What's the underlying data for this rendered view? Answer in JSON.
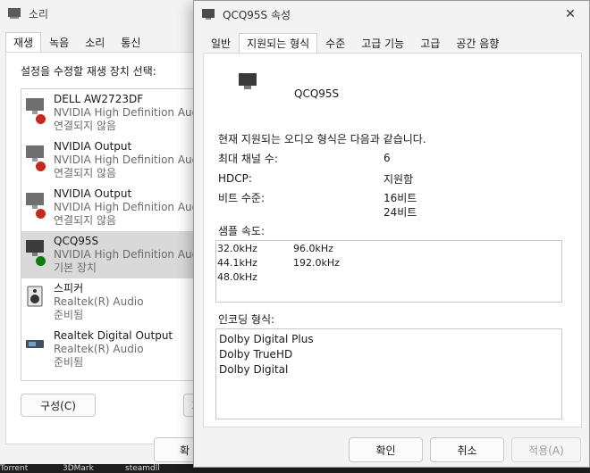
{
  "sound_window": {
    "title": "소리",
    "tabs": [
      "재생",
      "녹음",
      "소리",
      "통신"
    ],
    "instruction": "설정을 수정할 재생 장치 선택:",
    "devices": [
      {
        "name": "DELL AW2723DF",
        "driver": "NVIDIA High Definition Audio",
        "status": "연결되지 않음"
      },
      {
        "name": "NVIDIA Output",
        "driver": "NVIDIA High Definition Audio",
        "status": "연결되지 않음"
      },
      {
        "name": "NVIDIA Output",
        "driver": "NVIDIA High Definition Audio",
        "status": "연결되지 않음"
      },
      {
        "name": "QCQ95S",
        "driver": "NVIDIA High Definition Audio",
        "status": "기본 장치"
      },
      {
        "name": "스피커",
        "driver": "Realtek(R) Audio",
        "status": "준비됨"
      },
      {
        "name": "Realtek Digital Output",
        "driver": "Realtek(R) Audio",
        "status": "준비됨"
      }
    ],
    "configure_label": "구성(C)",
    "set_default_cut": "기",
    "ok_cut": "확"
  },
  "properties_window": {
    "title": "QCQ95S 속성",
    "close_label": "✕",
    "tabs": [
      "일반",
      "지원되는 형식",
      "수준",
      "고급 기능",
      "고급",
      "공간 음향"
    ],
    "device_name": "QCQ95S",
    "intro": "현재 지원되는 오디오 형식은 다음과 같습니다.",
    "max_channels_label": "최대 채널 수:",
    "max_channels_value": "6",
    "hdcp_label": "HDCP:",
    "hdcp_value": "지원함",
    "bit_depth_label": "비트 수준:",
    "bit_depth_values": [
      "16비트",
      "24비트"
    ],
    "sample_rate_label": "샘플 속도:",
    "sample_rates": [
      "32.0kHz",
      "44.1kHz",
      "48.0kHz",
      "96.0kHz",
      "192.0kHz"
    ],
    "encoding_label": "인코딩 형식:",
    "encodings": [
      "Dolby Digital Plus",
      "Dolby TrueHD",
      "Dolby Digital"
    ],
    "ok_label": "확인",
    "cancel_label": "취소",
    "apply_label": "적용(A)"
  },
  "taskbar": {
    "items": [
      "Torrent",
      "3DMark",
      "steamdll"
    ]
  },
  "colors": {
    "selected_row": "#d9d9d9",
    "status_red": "#c42b1c",
    "status_green": "#0f7b0f"
  }
}
